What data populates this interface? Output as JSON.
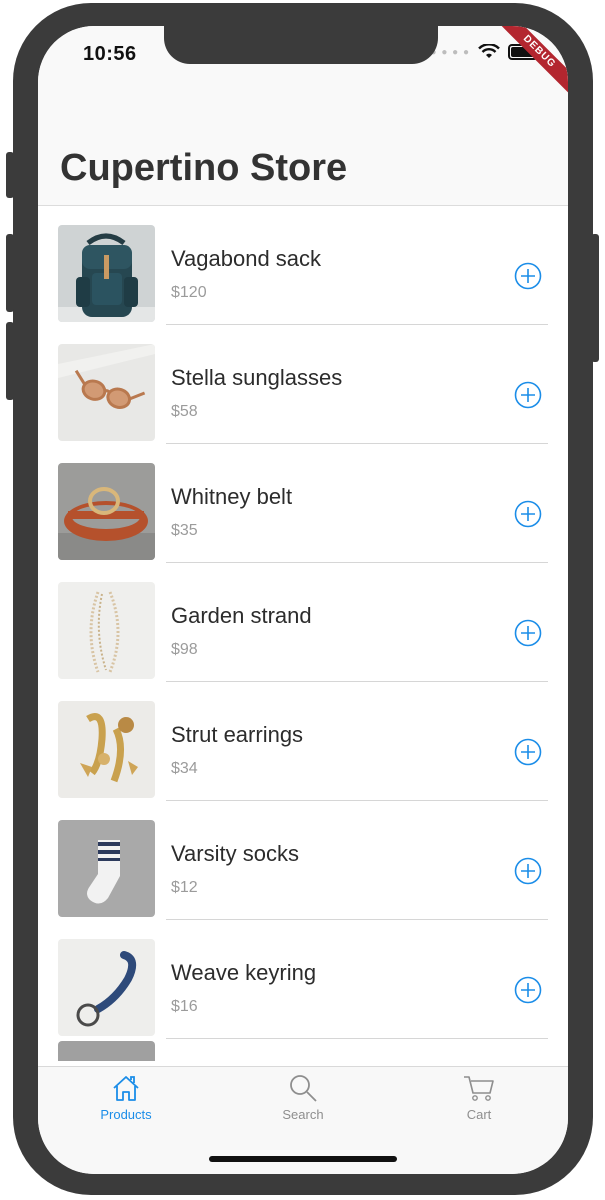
{
  "status_bar": {
    "time": "10:56",
    "debug_label": "DEBUG"
  },
  "nav": {
    "title": "Cupertino Store"
  },
  "products": [
    {
      "name": "Vagabond sack",
      "price": "$120"
    },
    {
      "name": "Stella sunglasses",
      "price": "$58"
    },
    {
      "name": "Whitney belt",
      "price": "$35"
    },
    {
      "name": "Garden strand",
      "price": "$98"
    },
    {
      "name": "Strut earrings",
      "price": "$34"
    },
    {
      "name": "Varsity socks",
      "price": "$12"
    },
    {
      "name": "Weave keyring",
      "price": "$16"
    }
  ],
  "tabs": [
    {
      "label": "Products",
      "icon": "home-icon",
      "active": true
    },
    {
      "label": "Search",
      "icon": "search-icon",
      "active": false
    },
    {
      "label": "Cart",
      "icon": "cart-icon",
      "active": false
    }
  ],
  "colors": {
    "accent": "#1b8de8",
    "inactive": "#8e8e8e",
    "frame": "#3b3b3b",
    "debug": "#b3262f"
  }
}
